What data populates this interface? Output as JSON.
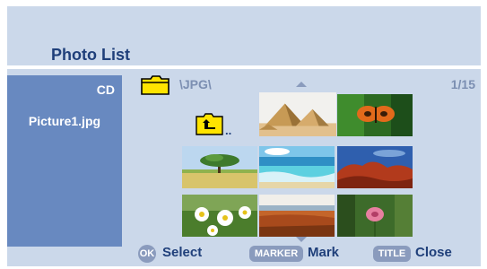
{
  "header": {
    "title": "Photo List"
  },
  "sidebar": {
    "source": "CD",
    "file_name": "Picture1.jpg"
  },
  "browser": {
    "folder_path": "\\JPG\\",
    "page_counter": "1/15",
    "up_folder_label": "..",
    "thumbnails": [
      {
        "subject": "pyramids",
        "selected": true
      },
      {
        "subject": "butterfly",
        "selected": false
      },
      {
        "subject": "tree",
        "selected": false
      },
      {
        "subject": "beach",
        "selected": false
      },
      {
        "subject": "red-rocks",
        "selected": false
      },
      {
        "subject": "daisies",
        "selected": false
      },
      {
        "subject": "field",
        "selected": false
      },
      {
        "subject": "pink-flower",
        "selected": false
      }
    ]
  },
  "footer": {
    "ok_badge": "OK",
    "select_label": "Select",
    "marker_badge": "MARKER",
    "mark_label": "Mark",
    "title_badge": "TITLE",
    "close_label": "Close"
  },
  "colors": {
    "panel": "#cbd8ea",
    "sidebar": "#6889c0",
    "accent": "#1f3f7a",
    "badge": "#8a9bbd",
    "folder": "#ffe400"
  }
}
